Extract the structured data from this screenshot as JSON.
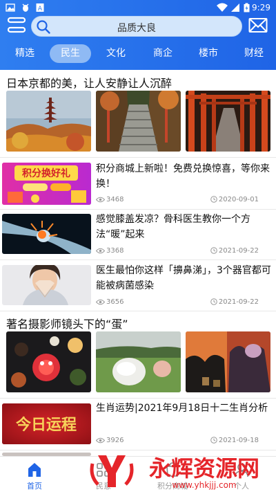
{
  "status_bar": {
    "time": "9:29"
  },
  "search": {
    "text": "品质大良"
  },
  "tabs": [
    {
      "label": "精选",
      "active": false
    },
    {
      "label": "民生",
      "active": true
    },
    {
      "label": "文化",
      "active": false
    },
    {
      "label": "商企",
      "active": false
    },
    {
      "label": "楼市",
      "active": false
    },
    {
      "label": "财经",
      "active": false
    }
  ],
  "sections": {
    "s1_title": "日本京都的美，让人安静让人沉醉",
    "s2_title": "著名摄影师镜头下的“蛋”"
  },
  "articles": [
    {
      "title": "积分商城上新啦！免费兑换惊喜，等你来换！",
      "views": "3468",
      "date": "2020-09-01",
      "thumb_text": "积分换好礼"
    },
    {
      "title": "感觉膝盖发凉？骨科医生教你一个方法“暖”起来",
      "views": "3368",
      "date": "2021-09-22"
    },
    {
      "title": "医生最怕你这样「擤鼻涕」，3个器官都可能被病菌感染",
      "views": "3656",
      "date": "2021-09-22"
    },
    {
      "title": "生肖运势|2021年9月18日十二生肖分析",
      "views": "3926",
      "date": "2021-09-18",
      "thumb_text": "今日运程"
    }
  ],
  "bottom_nav": [
    {
      "label": "首页",
      "icon": "home-icon",
      "active": true
    },
    {
      "label": "民意",
      "icon": "grid-icon",
      "active": false
    },
    {
      "label": "积分商城",
      "icon": "shop-icon",
      "active": false
    },
    {
      "label": "个人",
      "icon": "person-icon",
      "active": false
    }
  ],
  "watermark": {
    "text": "永辉资源网",
    "url": "www.yhkjjj.com"
  },
  "colors": {
    "brand": "#1f64e6",
    "tab_active_bg": "#8fbaf4",
    "watermark": "#e5252a"
  }
}
